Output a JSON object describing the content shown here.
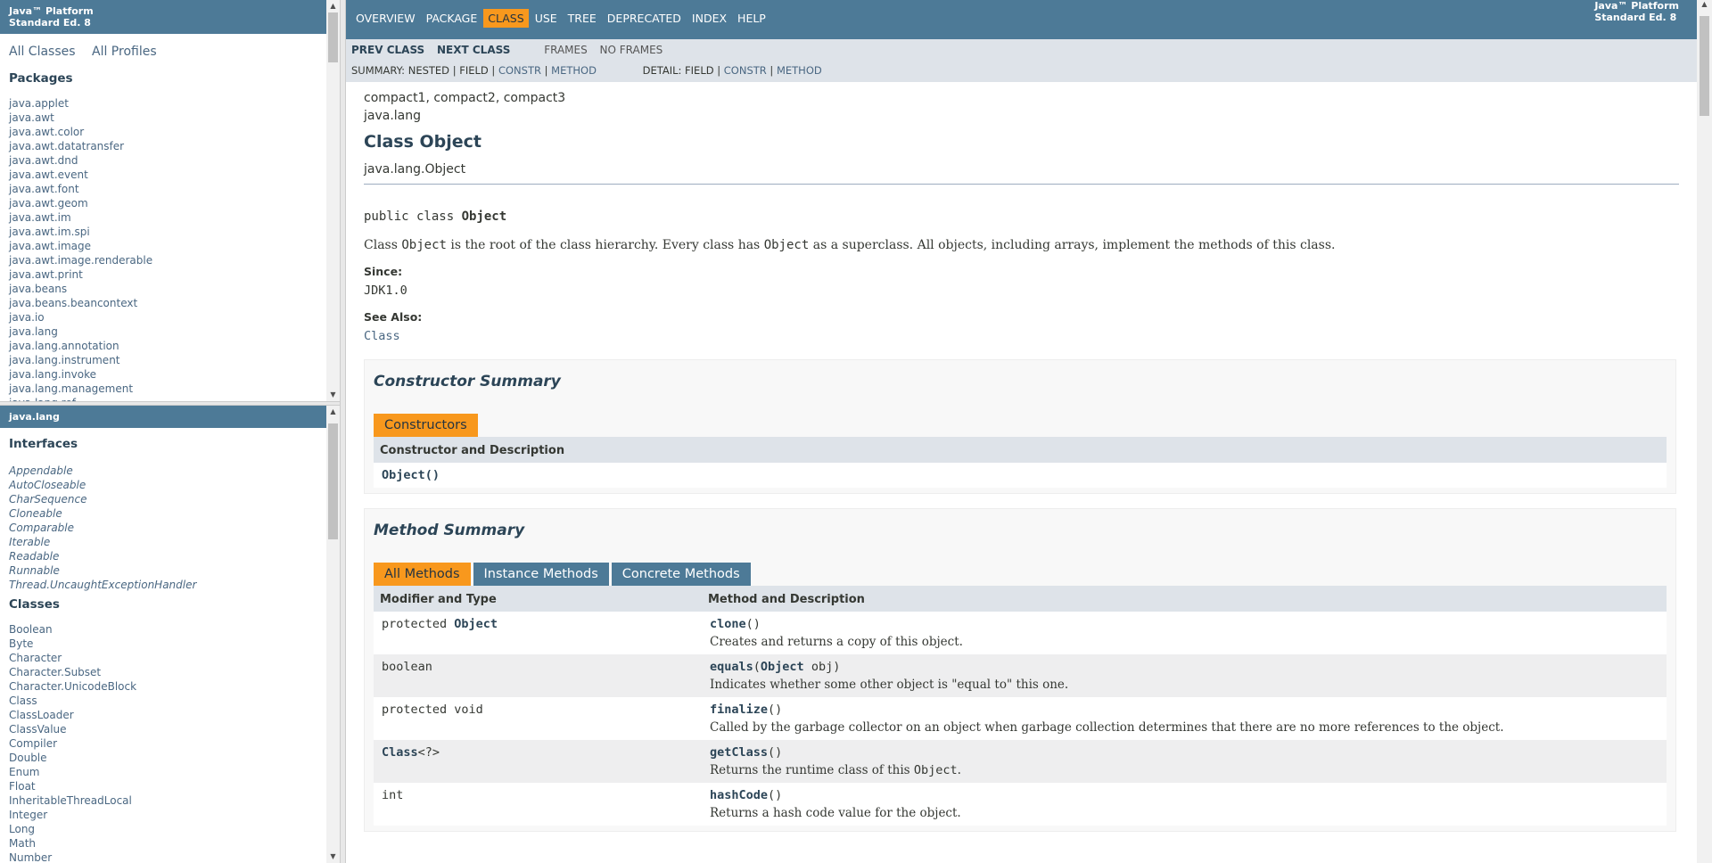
{
  "left_top": {
    "title_line1": "Java™ Platform",
    "title_line2": "Standard Ed. 8",
    "all_classes": "All Classes",
    "all_profiles": "All Profiles",
    "packages_heading": "Packages",
    "packages": [
      "java.applet",
      "java.awt",
      "java.awt.color",
      "java.awt.datatransfer",
      "java.awt.dnd",
      "java.awt.event",
      "java.awt.font",
      "java.awt.geom",
      "java.awt.im",
      "java.awt.im.spi",
      "java.awt.image",
      "java.awt.image.renderable",
      "java.awt.print",
      "java.beans",
      "java.beans.beancontext",
      "java.io",
      "java.lang",
      "java.lang.annotation",
      "java.lang.instrument",
      "java.lang.invoke",
      "java.lang.management",
      "java.lang.ref"
    ]
  },
  "left_bottom": {
    "package_title": "java.lang",
    "interfaces_heading": "Interfaces",
    "interfaces": [
      "Appendable",
      "AutoCloseable",
      "CharSequence",
      "Cloneable",
      "Comparable",
      "Iterable",
      "Readable",
      "Runnable",
      "Thread.UncaughtExceptionHandler"
    ],
    "classes_heading": "Classes",
    "classes": [
      "Boolean",
      "Byte",
      "Character",
      "Character.Subset",
      "Character.UnicodeBlock",
      "Class",
      "ClassLoader",
      "ClassValue",
      "Compiler",
      "Double",
      "Enum",
      "Float",
      "InheritableThreadLocal",
      "Integer",
      "Long",
      "Math",
      "Number"
    ]
  },
  "topnav": {
    "items": [
      "OVERVIEW",
      "PACKAGE",
      "CLASS",
      "USE",
      "TREE",
      "DEPRECATED",
      "INDEX",
      "HELP"
    ],
    "active": "CLASS",
    "about_line1": "Java™ Platform",
    "about_line2": "Standard Ed. 8"
  },
  "subnav": {
    "prev_class": "PREV CLASS",
    "next_class": "NEXT CLASS",
    "frames": "FRAMES",
    "no_frames": "NO FRAMES",
    "summary_label": "SUMMARY: ",
    "summary_nested": "NESTED",
    "summary_field": "FIELD",
    "summary_constr": "CONSTR",
    "summary_method": "METHOD",
    "detail_label": "DETAIL: ",
    "detail_field": "FIELD",
    "detail_constr": "CONSTR",
    "detail_method": "METHOD",
    "sep": " | "
  },
  "content": {
    "profiles": "compact1, compact2, compact3",
    "package": "java.lang",
    "class_title": "Class Object",
    "inheritance": "java.lang.Object",
    "sig_prefix": "public class ",
    "sig_name": "Object",
    "desc_1": "Class ",
    "desc_code1": "Object",
    "desc_2": " is the root of the class hierarchy. Every class has ",
    "desc_code2": "Object",
    "desc_3": " as a superclass. All objects, including arrays, implement the methods of this class.",
    "since_label": "Since:",
    "since_value": "JDK1.0",
    "see_also_label": "See Also:",
    "see_also_value": "Class"
  },
  "constructor_summary": {
    "heading": "Constructor Summary",
    "tab": "Constructors",
    "col": "Constructor and Description",
    "row": "Object()"
  },
  "method_summary": {
    "heading": "Method Summary",
    "tabs": [
      "All Methods",
      "Instance Methods",
      "Concrete Methods"
    ],
    "col1": "Modifier and Type",
    "col2": "Method and Description",
    "rows": [
      {
        "mod_prefix": "protected ",
        "mod_type": "Object",
        "name": "clone",
        "params_pre": "()",
        "params_type": "",
        "params_post": "",
        "desc": "Creates and returns a copy of this object."
      },
      {
        "mod_prefix": "boolean",
        "mod_type": "",
        "name": "equals",
        "params_pre": "(",
        "params_type": "Object",
        "params_post": " obj)",
        "desc": "Indicates whether some other object is \"equal to\" this one."
      },
      {
        "mod_prefix": "protected void",
        "mod_type": "",
        "name": "finalize",
        "params_pre": "()",
        "params_type": "",
        "params_post": "",
        "desc": "Called by the garbage collector on an object when garbage collection determines that there are no more references to the object."
      },
      {
        "mod_prefix": "",
        "mod_type": "Class",
        "mod_suffix": "<?>",
        "name": "getClass",
        "params_pre": "()",
        "params_type": "",
        "params_post": "",
        "desc": "Returns the runtime class of this ",
        "desc_code": "Object",
        "desc_end": "."
      },
      {
        "mod_prefix": "int",
        "mod_type": "",
        "name": "hashCode",
        "params_pre": "()",
        "params_type": "",
        "params_post": "",
        "desc": "Returns a hash code value for the object."
      }
    ]
  }
}
